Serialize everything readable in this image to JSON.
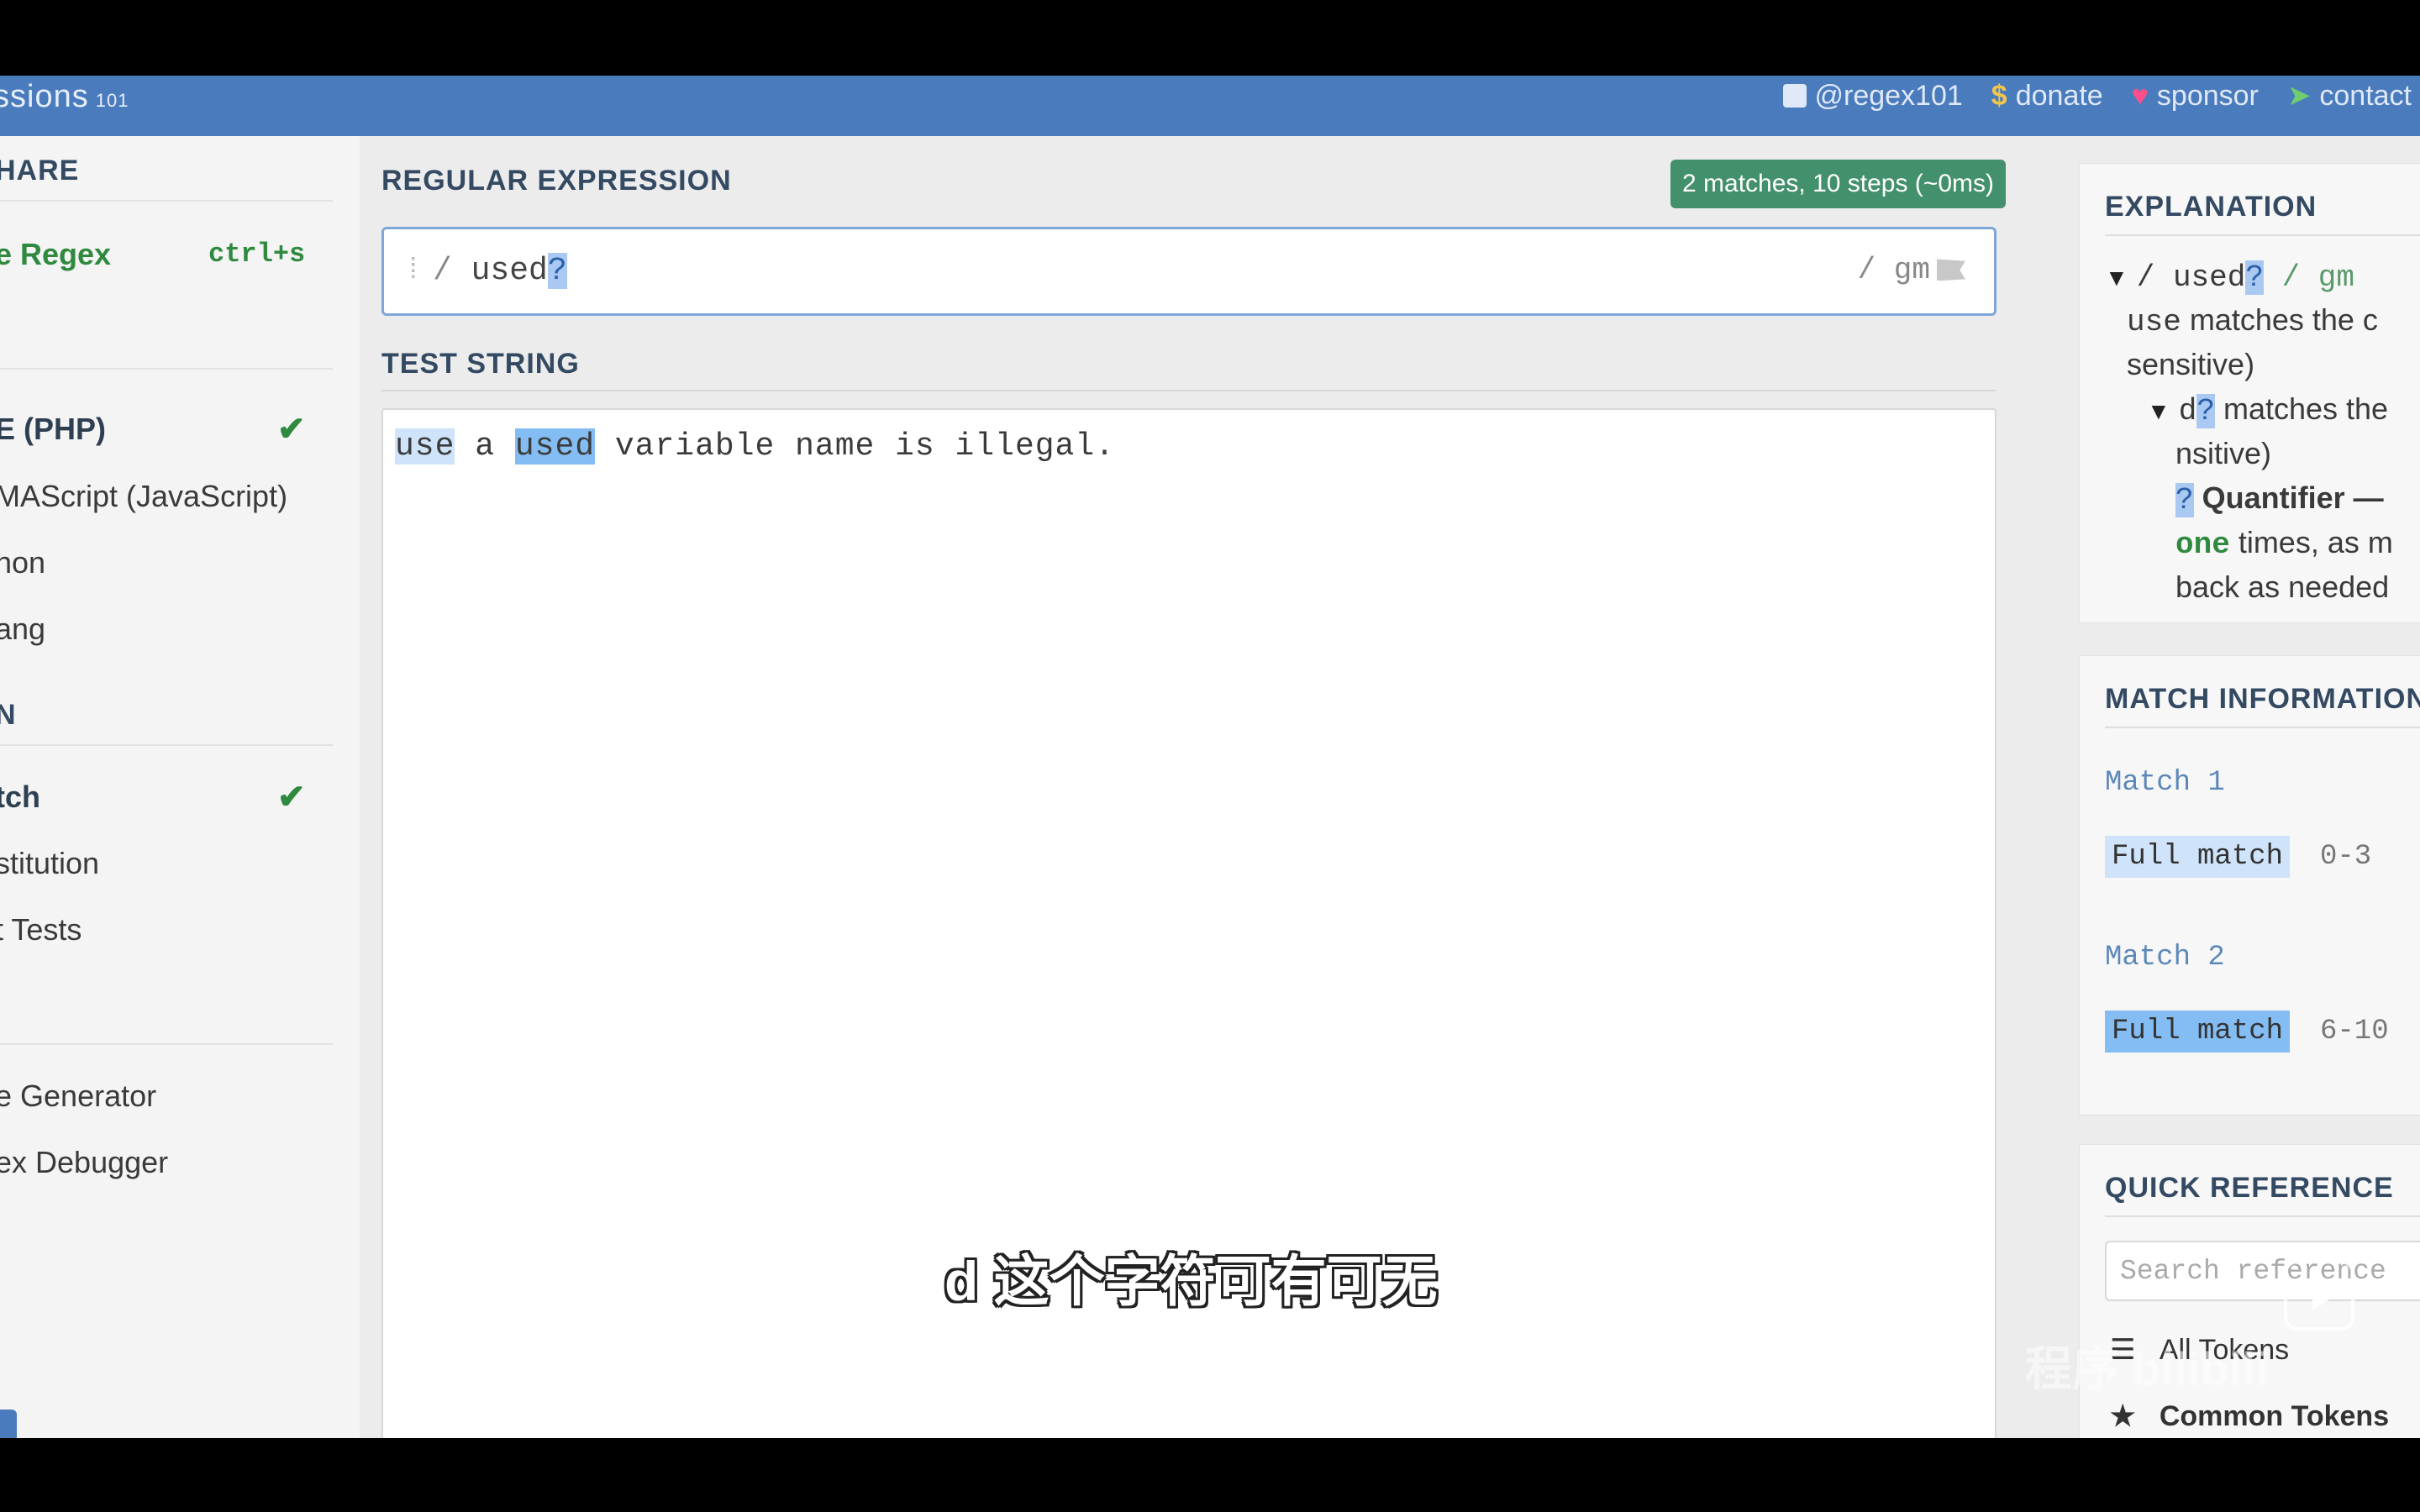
{
  "header": {
    "brand": "ssions",
    "brand_small": "101",
    "links": {
      "twitter": "@regex101",
      "donate": "donate",
      "sponsor": "sponsor",
      "contact": "contact"
    }
  },
  "sidebar": {
    "share_heading": "HARE",
    "save_label": "e Regex",
    "save_shortcut": "ctrl+s",
    "flavors": [
      {
        "label": "E (PHP)",
        "selected": true
      },
      {
        "label": "MAScript (JavaScript)",
        "selected": false
      },
      {
        "label": "hon",
        "selected": false
      },
      {
        "label": "ang",
        "selected": false
      }
    ],
    "function_heading": "N",
    "functions": [
      {
        "label": "tch",
        "selected": true
      },
      {
        "label": "stitution",
        "selected": false
      },
      {
        "label": "t Tests",
        "selected": false
      }
    ],
    "tools": [
      {
        "label": "e Generator"
      },
      {
        "label": "ex Debugger"
      }
    ]
  },
  "main": {
    "regex_heading": "REGULAR EXPRESSION",
    "match_badge": "2 matches, 10 steps (~0ms)",
    "regex_open_delim": "/",
    "regex_body": "used",
    "regex_quantifier": "?",
    "regex_flags": "/ gm",
    "test_heading": "TEST STRING",
    "test_string": {
      "m1": "use",
      "gap1": " a ",
      "m2": "used",
      "rest": " variable name is illegal."
    },
    "subtitle": "d 这个字符可有可无"
  },
  "explanation": {
    "heading": "EXPLANATION",
    "root_pre": "/ used",
    "root_q": "?",
    "root_post": " / gm",
    "line1_token": "use",
    "line1_text": " matches the c",
    "line2": "sensitive)",
    "sub_token_d": "d",
    "sub_token_q": "?",
    "sub_text": " matches the",
    "line4": "nsitive)",
    "quant_q": "?",
    "quant_label": " Quantifier —",
    "quant_one": "one",
    "quant_text": " times, as m",
    "line7": "back as needed"
  },
  "match_info": {
    "heading": "MATCH INFORMATION",
    "matches": [
      {
        "title": "Match 1",
        "label": "Full match",
        "range": "0-3"
      },
      {
        "title": "Match 2",
        "label": "Full match",
        "range": "6-10"
      }
    ]
  },
  "quick_ref": {
    "heading": "QUICK REFERENCE",
    "search_placeholder": "Search reference",
    "items": [
      "All Tokens",
      "Common Tokens"
    ]
  },
  "overlay": {
    "watermark": "程序 bilibili"
  }
}
